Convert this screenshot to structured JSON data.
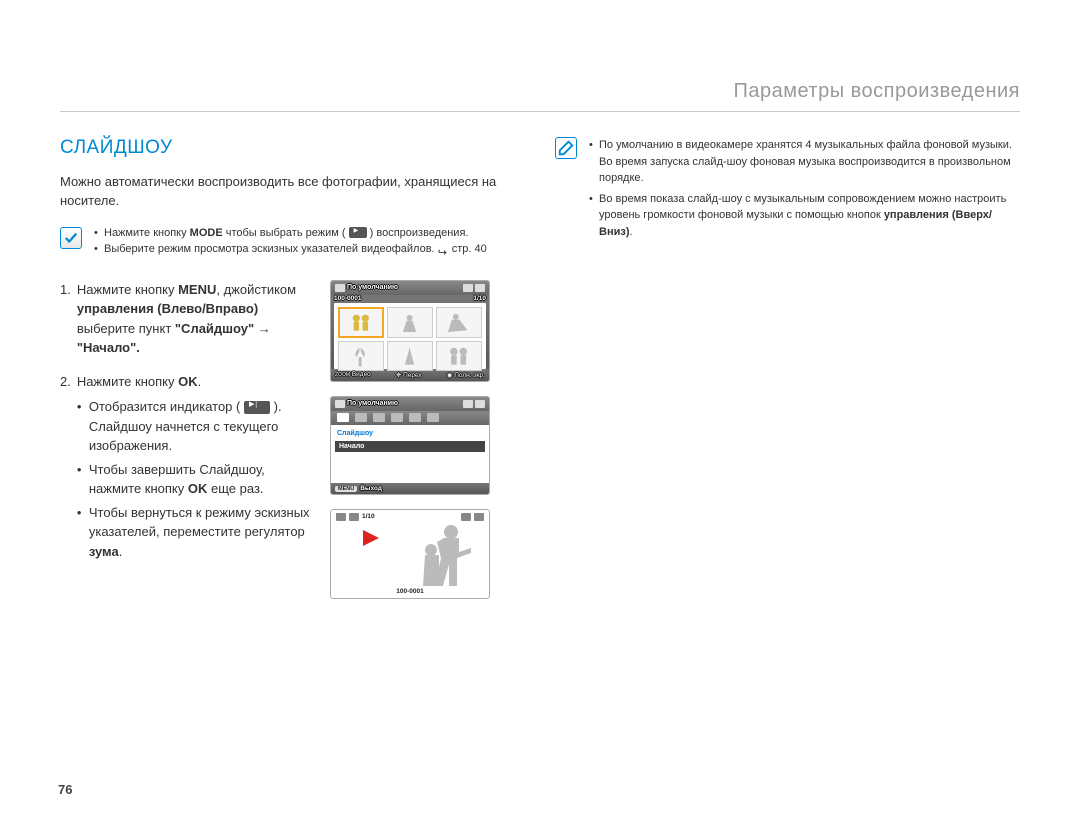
{
  "breadcrumb": "Параметры воспроизведения",
  "section_title": "СЛАЙДШОУ",
  "intro": "Можно автоматически воспроизводить все фотографии, хранящиеся на носителе.",
  "pre_note": {
    "items": [
      {
        "prefix": "Нажмите кнопку ",
        "bold": "MODE",
        "suffix": " чтобы выбрать режим (",
        "suffix2": ") воспроизведения."
      },
      {
        "text": "Выберите режим просмотра эскизных указателей видеофайлов. ",
        "page_ref": "стр. 40"
      }
    ]
  },
  "steps": [
    {
      "num": "1.",
      "parts": {
        "a": "Нажмите кнопку ",
        "b": "MENU",
        "c": ", джойстиком ",
        "d": "управления (Влево/Вправо)",
        "e": " выберите пункт ",
        "f": "\"Слайдшоу\" → \"Начало\"."
      }
    },
    {
      "num": "2.",
      "parts": {
        "a": "Нажмите кнопку ",
        "b": "OK",
        "c": "."
      },
      "subs": [
        {
          "a": "Отобразится индикатор (",
          "b": "). Слайдшоу начнется с текущего изображения."
        },
        {
          "a": "Чтобы завершить Слайдшоу, нажмите кнопку ",
          "b": "OK",
          "c": " еще раз."
        },
        {
          "a": "Чтобы вернуться к режиму эскизных указателей, переместите регулятор ",
          "b": "зума",
          "c": "."
        }
      ]
    }
  ],
  "screen1": {
    "title": "По умолчанию",
    "folio": "100-0001",
    "count": "1/10",
    "bottom_zoom": "ZOOM",
    "bottom_video": "Видео",
    "bottom_move": "Перех",
    "bottom_full": "Полн. экр."
  },
  "screen2": {
    "title": "По умолчанию",
    "menu_item": "Слайдшоу",
    "menu_sel": "Начало",
    "footer_badge": "MENU",
    "footer_text": "Выход"
  },
  "screen3": {
    "count": "1/10",
    "folio": "100-0001"
  },
  "right_note": {
    "items": [
      "По умолчанию в видеокамере хранятся 4 музыкальных файла фоновой музыки. Во время запуска слайд-шоу фоновая музыка воспроизводится в произвольном порядке.",
      {
        "a": "Во время показа слайд-шоу с музыкальным сопровождением можно настроить уровень громкости фоновой музыки с помощью кнопок ",
        "b": "управления (Вверх/Вниз)",
        "c": "."
      }
    ]
  },
  "page_number": "76"
}
